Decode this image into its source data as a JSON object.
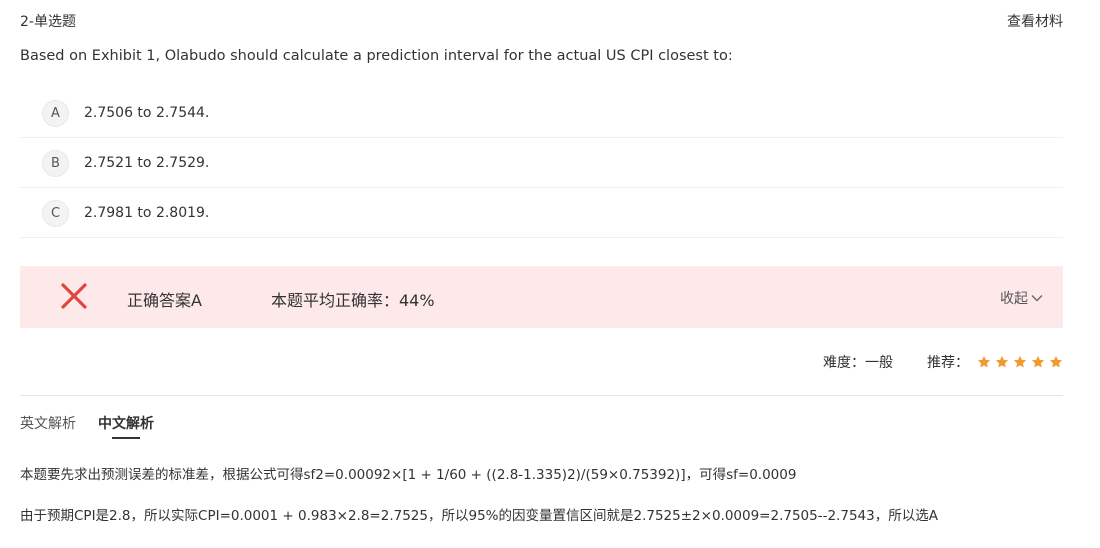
{
  "header": {
    "question_type": "2-单选题",
    "view_material": "查看材料"
  },
  "question": {
    "text": "Based on Exhibit 1, Olabudo should calculate a prediction interval for the actual US CPI closest to:",
    "options": [
      {
        "letter": "A",
        "text": "2.7506 to 2.7544."
      },
      {
        "letter": "B",
        "text": "2.7521 to 2.7529."
      },
      {
        "letter": "C",
        "text": "2.7981 to 2.8019."
      }
    ]
  },
  "result": {
    "correct_answer": "正确答案A",
    "average_rate": "本题平均正确率：44%",
    "collapse_label": "收起",
    "status_color": "#e0443e",
    "background_color": "#fde9e9"
  },
  "meta": {
    "difficulty": "难度：一般",
    "recommend_label": "推荐：",
    "recommend_stars": 5,
    "star_color": "#f29a2e"
  },
  "tabs": [
    {
      "label": "英文解析",
      "active": false
    },
    {
      "label": "中文解析",
      "active": true
    }
  ],
  "explanation": {
    "line1": "本题要先求出预测误差的标准差，根据公式可得sf2=0.00092×[1 + 1/60 + ((2.8-1.335)2)/(59×0.75392)]，可得sf=0.0009",
    "line2": "由于预期CPI是2.8，所以实际CPI=0.0001 + 0.983×2.8=2.7525，所以95%的因变量置信区间就是2.7525±2×0.0009=2.7505--2.7543，所以选A"
  }
}
